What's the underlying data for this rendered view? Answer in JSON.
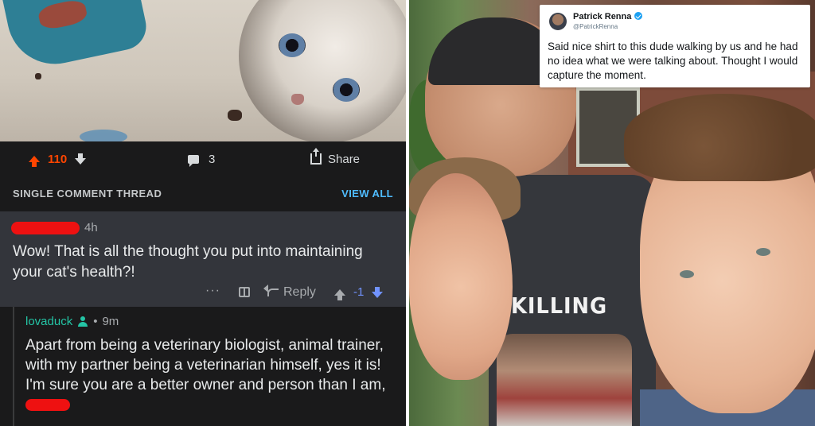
{
  "left": {
    "post": {
      "score": "110",
      "comment_count": "3",
      "share_label": "Share"
    },
    "thread": {
      "title": "SINGLE COMMENT THREAD",
      "view_all": "VIEW ALL"
    },
    "comment1": {
      "time": "4h",
      "text": "Wow! That is all the thought you put into maintaining your cat's health?!",
      "more": "···",
      "reply_label": "Reply",
      "score": "-1"
    },
    "comment2": {
      "username": "lovaduck",
      "time": "9m",
      "text": "Apart from being a veterinary biologist, animal trainer, with my partner being a veterinarian himself, yes it is! I'm sure you are a better owner and person than I am,"
    }
  },
  "right": {
    "tweet": {
      "name": "Patrick Renna",
      "handle": "@PatrickRenna",
      "text": "Said nice shirt to this dude walking by us and he had no idea what we were talking about. Thought I would capture the moment."
    },
    "shirt_text": "KILLING"
  },
  "colors": {
    "upvote": "#ff4500",
    "downvote": "#7193ff",
    "link": "#4fbcff",
    "username": "#24c4a5",
    "redaction": "#ee1111",
    "verified": "#1da1f2"
  }
}
